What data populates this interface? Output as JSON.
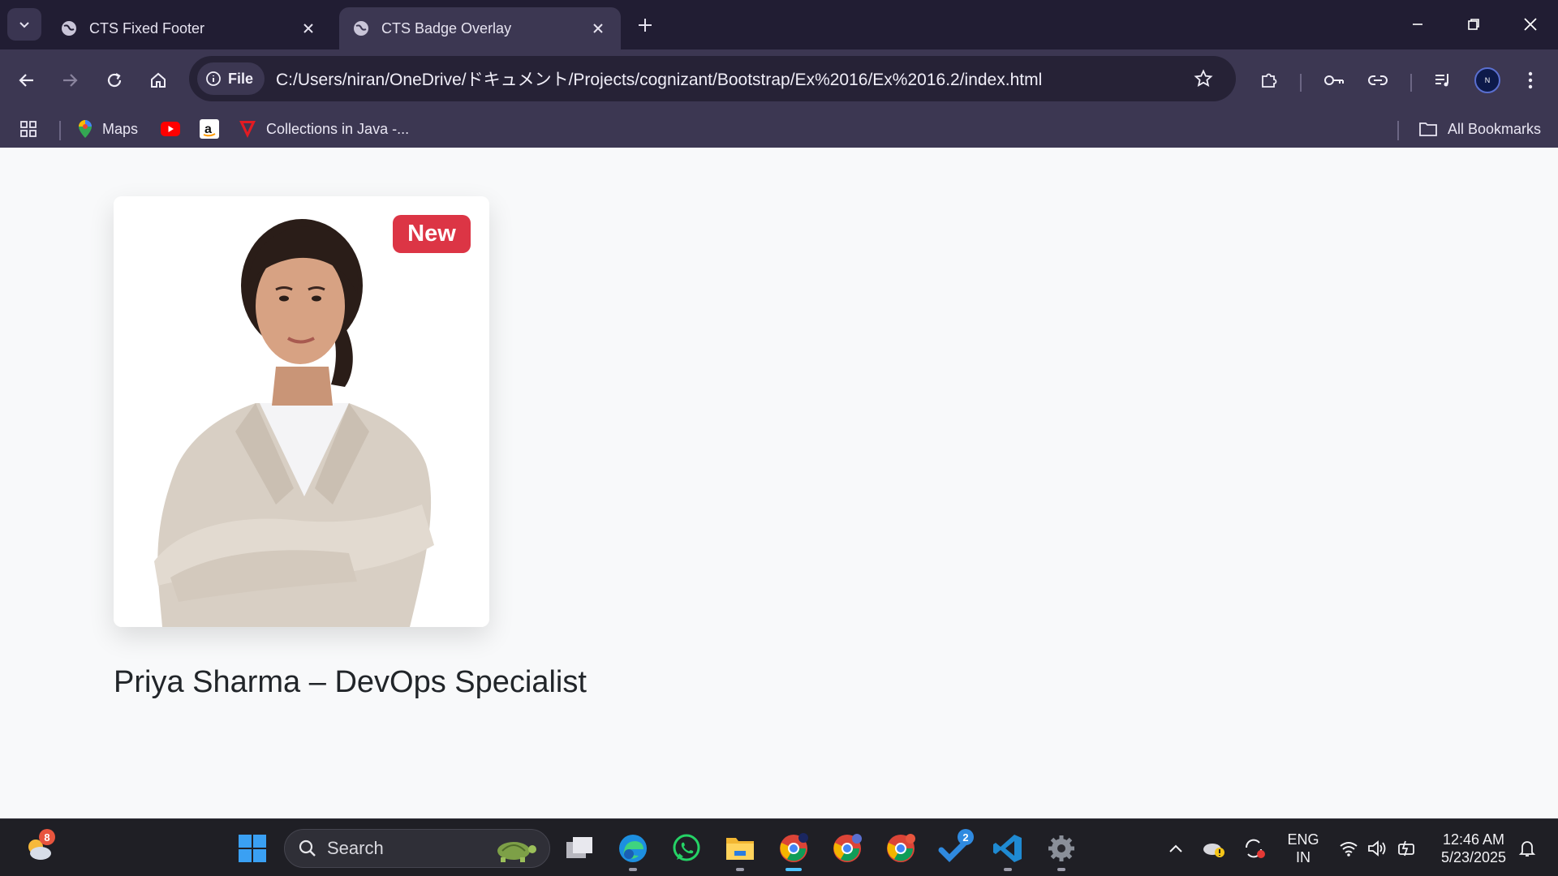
{
  "browser": {
    "tabs": [
      {
        "title": "CTS Fixed Footer",
        "active": false
      },
      {
        "title": "CTS Badge Overlay",
        "active": true
      }
    ],
    "omnibox": {
      "scheme_label": "File",
      "url": "C:/Users/niran/OneDrive/ドキュメント/Projects/cognizant/Bootstrap/Ex%2016/Ex%2016.2/index.html"
    },
    "bookmarks": [
      {
        "label": "Maps",
        "icon": "google-maps-icon"
      },
      {
        "label": "",
        "icon": "youtube-icon"
      },
      {
        "label": "",
        "icon": "amazon-icon"
      },
      {
        "label": "Collections in Java -...",
        "icon": "tpoint-icon"
      }
    ],
    "all_bookmarks_label": "All Bookmarks",
    "profile_initial": "N"
  },
  "page": {
    "card": {
      "badge_label": "New",
      "photo_alt": "Priya Sharma"
    },
    "caption": "Priya Sharma – DevOps Specialist"
  },
  "taskbar": {
    "weather_badge": "8",
    "search_placeholder": "Search",
    "todo_badge": "2",
    "language": "ENG",
    "region": "IN",
    "time": "12:46 AM",
    "date": "5/23/2025"
  },
  "colors": {
    "badge": "#dc3545",
    "titlebar": "#211d33",
    "toolbar": "#3c3752",
    "page_bg": "#f8f9fa"
  }
}
